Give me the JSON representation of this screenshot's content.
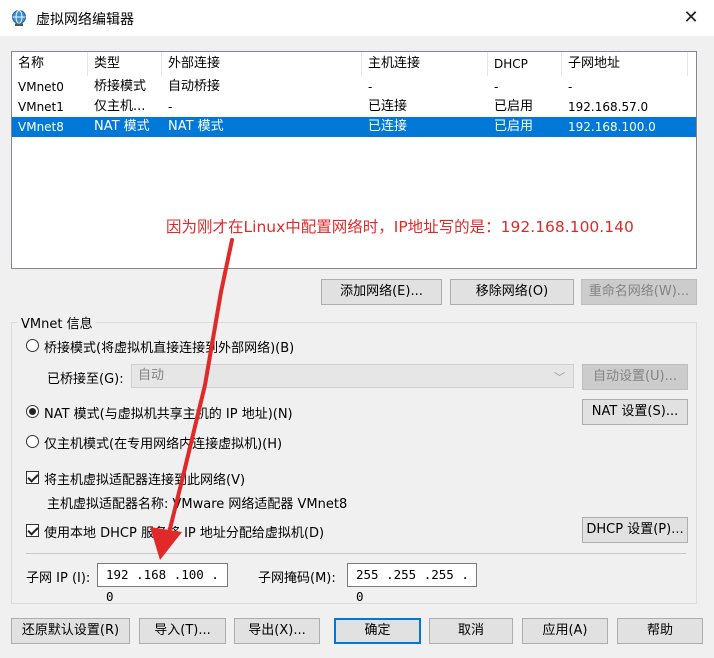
{
  "window": {
    "title": "虚拟网络编辑器",
    "app_icon": "globe-network-icon",
    "close_label": "✕"
  },
  "network_list": {
    "columns": [
      "名称",
      "类型",
      "外部连接",
      "主机连接",
      "DHCP",
      "子网地址"
    ],
    "rows": [
      {
        "name": "VMnet0",
        "type": "桥接模式",
        "external": "自动桥接",
        "host": "-",
        "dhcp": "-",
        "subnet": "-",
        "selected": false
      },
      {
        "name": "VMnet1",
        "type": "仅主机...",
        "external": "-",
        "host": "已连接",
        "dhcp": "已启用",
        "subnet": "192.168.57.0",
        "selected": false
      },
      {
        "name": "VMnet8",
        "type": "NAT 模式",
        "external": "NAT 模式",
        "host": "已连接",
        "dhcp": "已启用",
        "subnet": "192.168.100.0",
        "selected": true
      }
    ]
  },
  "annotation": {
    "text": "因为刚才在Linux中配置网络时，IP地址写的是：192.168.100.140",
    "color": "#e02a2a"
  },
  "list_buttons": {
    "add": "添加网络(E)...",
    "remove": "移除网络(O)",
    "rename": "重命名网络(W)..."
  },
  "vmnet_info": {
    "group_label": "VMnet 信息",
    "bridged_radio": "桥接模式(将虚拟机直接连接到外部网络)(B)",
    "bridged_to_label": "已桥接至(G):",
    "bridged_to_value": "自动",
    "auto_settings": "自动设置(U)...",
    "nat_radio": "NAT 模式(与虚拟机共享主机的 IP 地址)(N)",
    "nat_settings": "NAT 设置(S)...",
    "hostonly_radio": "仅主机模式(在专用网络内连接虚拟机)(H)",
    "connect_adapter_check": "将主机虚拟适配器连接到此网络(V)",
    "adapter_name": "主机虚拟适配器名称: VMware 网络适配器 VMnet8",
    "dhcp_check": "使用本地 DHCP 服务将 IP 地址分配给虚拟机(D)",
    "dhcp_settings": "DHCP 设置(P)...",
    "subnet_ip_label": "子网 IP (I):",
    "subnet_ip_value": "192 .168 .100 . 0",
    "subnet_mask_label": "子网掩码(M):",
    "subnet_mask_value": "255 .255 .255 . 0",
    "selected_mode": "nat",
    "connect_adapter_checked": true,
    "dhcp_checked": true
  },
  "footer_buttons": {
    "restore": "还原默认设置(R)",
    "import": "导入(T)...",
    "export": "导出(X)...",
    "ok": "确定",
    "cancel": "取消",
    "apply": "应用(A)",
    "help": "帮助"
  },
  "colors": {
    "selection": "#0078d7",
    "arrow": "#e02a2a"
  }
}
